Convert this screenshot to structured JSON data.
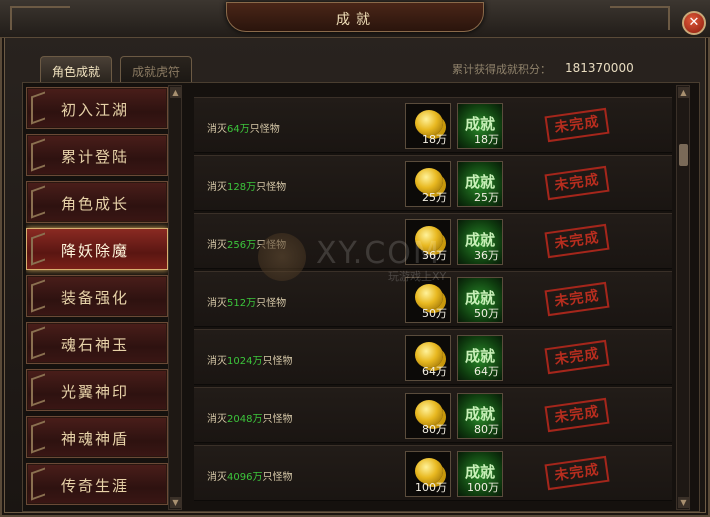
{
  "window": {
    "title": "成就",
    "close_icon": "✕"
  },
  "tabs": [
    {
      "label": "角色成就",
      "active": true
    },
    {
      "label": "成就虎符",
      "active": false
    }
  ],
  "points": {
    "label": "累计获得成就积分：",
    "value": "181370000"
  },
  "sidebar": {
    "items": [
      {
        "label": "初入江湖",
        "active": false
      },
      {
        "label": "累计登陆",
        "active": false
      },
      {
        "label": "角色成长",
        "active": false
      },
      {
        "label": "降妖除魔",
        "active": true
      },
      {
        "label": "装备强化",
        "active": false
      },
      {
        "label": "魂石神玉",
        "active": false
      },
      {
        "label": "光翼神印",
        "active": false
      },
      {
        "label": "神魂神盾",
        "active": false
      },
      {
        "label": "传奇生涯",
        "active": false
      }
    ]
  },
  "achievements": [
    {
      "prefix": "消灭",
      "number": "64万",
      "suffix": "只怪物",
      "coin_reward": "18万",
      "points_reward": "18万",
      "badge": "成就",
      "status": "未完成"
    },
    {
      "prefix": "消灭",
      "number": "128万",
      "suffix": "只怪物",
      "coin_reward": "25万",
      "points_reward": "25万",
      "badge": "成就",
      "status": "未完成"
    },
    {
      "prefix": "消灭",
      "number": "256万",
      "suffix": "只怪物",
      "coin_reward": "36万",
      "points_reward": "36万",
      "badge": "成就",
      "status": "未完成"
    },
    {
      "prefix": "消灭",
      "number": "512万",
      "suffix": "只怪物",
      "coin_reward": "50万",
      "points_reward": "50万",
      "badge": "成就",
      "status": "未完成"
    },
    {
      "prefix": "消灭",
      "number": "1024万",
      "suffix": "只怪物",
      "coin_reward": "64万",
      "points_reward": "64万",
      "badge": "成就",
      "status": "未完成"
    },
    {
      "prefix": "消灭",
      "number": "2048万",
      "suffix": "只怪物",
      "coin_reward": "80万",
      "points_reward": "80万",
      "badge": "成就",
      "status": "未完成"
    },
    {
      "prefix": "消灭",
      "number": "4096万",
      "suffix": "只怪物",
      "coin_reward": "100万",
      "points_reward": "100万",
      "badge": "成就",
      "status": "未完成"
    }
  ],
  "scroll": {
    "up_arrow": "▲",
    "down_arrow": "▼"
  },
  "watermark": {
    "text": "XY.COM",
    "sub": "玩游戏上XY"
  }
}
